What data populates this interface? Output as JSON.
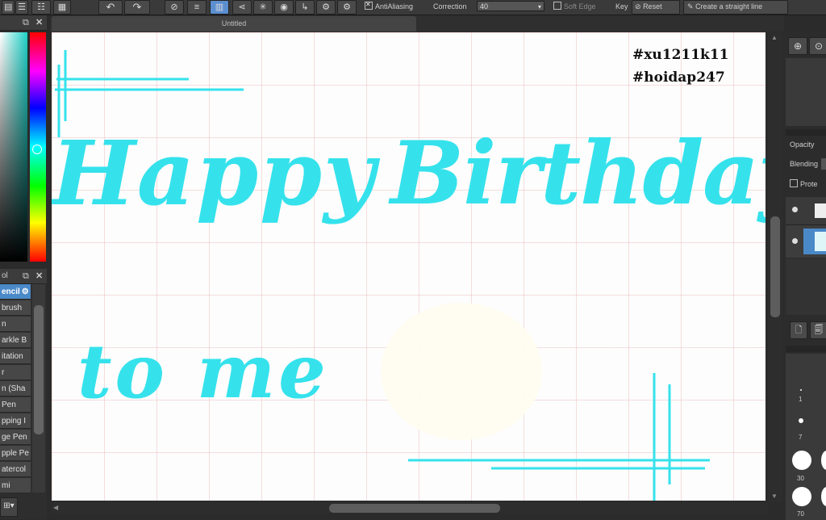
{
  "toolbar": {
    "antialiasing_label": "AntiAliasing",
    "correction_label": "Correction",
    "correction_value": "40",
    "soft_edge_label": "Soft Edge",
    "key_label": "Key",
    "reset_label": "Reset",
    "straight_line_label": "Create a straight line"
  },
  "document": {
    "tab_title": "Untitled"
  },
  "brush_panel": {
    "title": "ol",
    "items": [
      "encil",
      "brush",
      "n",
      "arkle B",
      "itation",
      "r",
      "n (Sha",
      "Pen",
      "pping I",
      "ge Pen",
      "pple Pe",
      "atercol",
      "mi"
    ]
  },
  "layers_panel": {
    "opacity_label": "Opacity",
    "blending_label": "Blending",
    "protect_label": "Prote"
  },
  "brush_sizes": [
    "1",
    "7",
    "30",
    "70"
  ],
  "canvas": {
    "hashtag_1": "#xu1211k11",
    "hashtag_2": "#hoidap247",
    "lettering_line_1_word_1": "Happy",
    "lettering_line_1_word_2": "Birthday",
    "lettering_line_2": "to me"
  },
  "colors": {
    "lettering": "#35e2ec",
    "selected_brush": "#4a89c8",
    "ui_dark": "#2b2b2b"
  },
  "icons": [
    "undo-icon",
    "redo-icon",
    "close-icon",
    "gear-icon",
    "zoom-icon",
    "new-layer-icon",
    "visibility-icon"
  ]
}
